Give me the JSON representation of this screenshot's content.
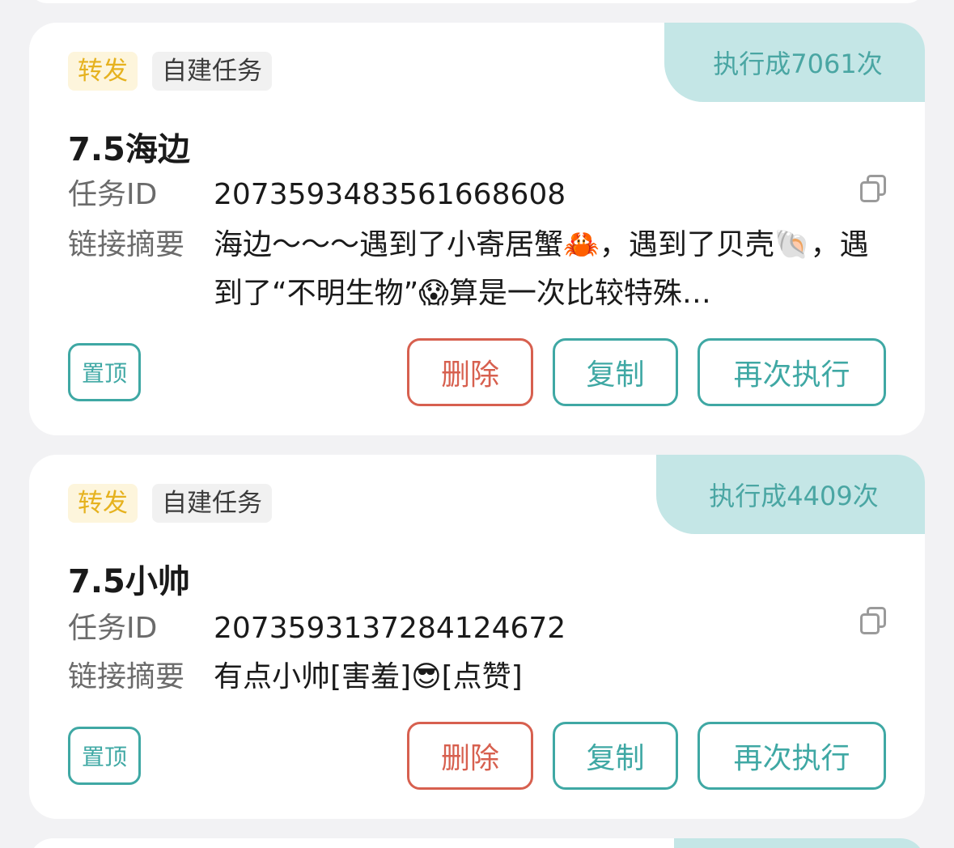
{
  "cards": [
    {
      "exec_badge": "执行成7061次",
      "tags": {
        "forward": "转发",
        "self": "自建任务"
      },
      "title": "7.5海边",
      "id_label": "任务ID",
      "id_value": "2073593483561668608",
      "summary_label": "链接摘要",
      "summary_value": "海边～～～遇到了小寄居蟹🦀，遇到了贝壳🐚，遇到了“不明生物”😱算是一次比较特殊…",
      "buttons": {
        "pin": "置顶",
        "delete": "删除",
        "copy": "复制",
        "again": "再次执行"
      }
    },
    {
      "exec_badge": "执行成4409次",
      "tags": {
        "forward": "转发",
        "self": "自建任务"
      },
      "title": "7.5小帅",
      "id_label": "任务ID",
      "id_value": "2073593137284124672",
      "summary_label": "链接摘要",
      "summary_value": "有点小帅[害羞]😎[点赞]",
      "buttons": {
        "pin": "置顶",
        "delete": "删除",
        "copy": "复制",
        "again": "再次执行"
      }
    }
  ],
  "colors": {
    "accent_teal": "#3fa8a4",
    "badge_bg": "#c4e6e6",
    "delete_red": "#d7604f",
    "tag_forward_text": "#e6b21f",
    "tag_forward_bg": "#fdf5dc"
  },
  "icons": {
    "copy": "copy-icon"
  }
}
